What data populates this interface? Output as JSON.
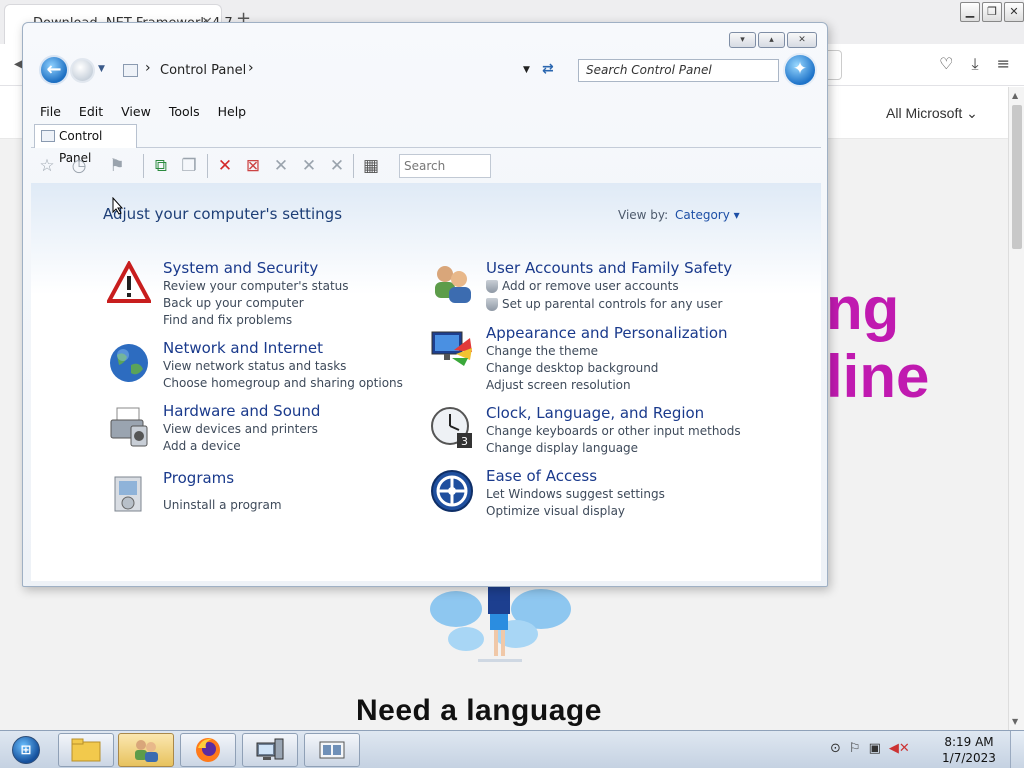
{
  "browser": {
    "tab_title": "Download .NET Framework 4.7",
    "tab_close": "×",
    "new_tab": "+",
    "nav_link": "All Microsoft",
    "hero_line1": "ng",
    "hero_line2": "line",
    "hero_subtitle": "Need a language",
    "accent_color": "#c01ab0"
  },
  "window": {
    "min_label": "▾",
    "max_label": "▴",
    "close_label": "✕",
    "breadcrumb": "Control Panel",
    "search_placeholder": "Search Control Panel"
  },
  "menubar": [
    "File",
    "Edit",
    "View",
    "Tools",
    "Help"
  ],
  "tab": {
    "label": "Control Panel"
  },
  "toolbar": {
    "search_placeholder": "Search"
  },
  "content": {
    "heading": "Adjust your computer's settings",
    "view_by_label": "View by:",
    "view_by_value": "Category",
    "categories": [
      {
        "title": "System and Security",
        "icon": "warning-shield-icon",
        "links": [
          "Review your computer's status",
          "Back up your computer",
          "Find and fix problems"
        ]
      },
      {
        "title": "Network and Internet",
        "icon": "globe-icon",
        "links": [
          "View network status and tasks",
          "Choose homegroup and sharing options"
        ]
      },
      {
        "title": "Hardware and Sound",
        "icon": "printer-icon",
        "links": [
          "View devices and printers",
          "Add a device"
        ]
      },
      {
        "title": "Programs",
        "icon": "programs-icon",
        "links": [
          "Uninstall a program"
        ]
      },
      {
        "title": "User Accounts and Family Safety",
        "icon": "users-icon",
        "links": [
          "Add or remove user accounts",
          "Set up parental controls for any user"
        ]
      },
      {
        "title": "Appearance and Personalization",
        "icon": "monitor-palette-icon",
        "links": [
          "Change the theme",
          "Change desktop background",
          "Adjust screen resolution"
        ]
      },
      {
        "title": "Clock, Language, and Region",
        "icon": "clock-icon",
        "links": [
          "Change keyboards or other input methods",
          "Change display language"
        ]
      },
      {
        "title": "Ease of Access",
        "icon": "ease-of-access-icon",
        "links": [
          "Let Windows suggest settings",
          "Optimize visual display"
        ]
      }
    ]
  },
  "taskbar": {
    "time": "8:19 AM",
    "date": "1/7/2023"
  }
}
